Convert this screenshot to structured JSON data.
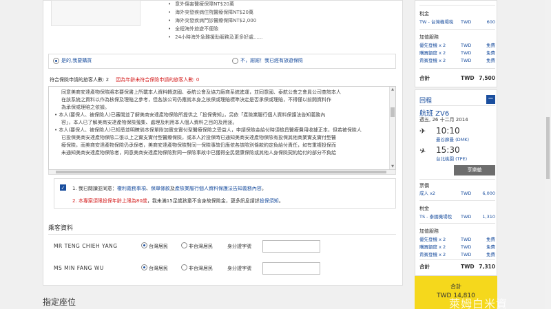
{
  "insurance": {
    "bullets": [
      "意外傷害醫療保障NT$20萬",
      "海外突發疾病住院醫療保障NT$20萬",
      "海外突發疾病門診醫療保障NT$2,000",
      "全程海外旅遊不便險",
      "24小時海外急難援助服務及更多好處......"
    ],
    "yes_label": "是的,我要購買",
    "no_label": "不，謝謝！我已經有旅遊保險",
    "eligible_label": "符合保險申請的旅客人數: 2",
    "ineligible_label": "因為年齡未符合保險申請的旅客人數: 0",
    "terms": [
      "同意美商安達產物保險將本要保書上所載本人資料轉送國、泰航公會及協力廠商系統進運，並同意國、泰航公會之會員公司查詢本人",
      "在該系統之資料以作為核保及理賠之參考，但各該公司仍應就本身之核保或理賠標準決定是否承保或理賠，不得僅以前開資料作",
      "為承保或理賠之依據。",
      "本人(要保人、被保險人)已審閱並了解美商安達產物保險所提供之「投保需知」，另依「產險業履行個人資料保護法告知義務內",
      "容」，本人已了解美商安達產物保險蒐集、處理及利用本人個人資料之目的及用途。",
      "本人(要保人、被保險人)已知悉並明瞭倘本保單附加實支實付型醫療保險之受益人，申請保險金給付時須檢具醫療費用收據正本，但若被保險人",
      "已投保美商安達產物保險二張以上之實支實付型醫療保險，或本人於投保時已通知美商安達產物保險有投保其他商業實支實付型醫",
      "療保險，而美商安達產物保險仍承保者，美商安達產物保險對同一保險事故仍應依各該險別條款約定負給付責任，如有重複投保而",
      "未通知美商安達產物保險者，同意美商安達產物保險對同一保險事故中已獲得全民健康保險或其他人身保險契約給付的部分不負給"
    ],
    "agree_1_prefix": "1. 我已閱讀並同意：",
    "agree_1_link1": "權利義務事項",
    "agree_1_mid": "、",
    "agree_1_link2": "保單條款",
    "agree_1_sep": "及",
    "agree_1_link3": "產險業履行個人資料保護法告知義務內容",
    "agree_1_suffix": "。",
    "agree_2_red": "2. 本專案須限投保年齡上限為80歲",
    "agree_2_text": "，我未滿15足歲孩童不含身故保險金，更多訊息請詳",
    "agree_2_link": "投保須知",
    "agree_2_end": "。"
  },
  "passengers": {
    "title": "乘客資料",
    "list": [
      {
        "name": "MR  TENG CHIEH  YANG",
        "resident": "台灣居民",
        "non_resident": "非台灣居民",
        "id_label": "身分證字號",
        "id_value": ""
      },
      {
        "name": "MS  MIN FANG  WU",
        "resident": "台灣居民",
        "non_resident": "非台灣居民",
        "id_label": "身分證字號",
        "id_value": ""
      }
    ]
  },
  "designate_title": "指定座位",
  "summary": {
    "outbound": {
      "tax_label": "稅金",
      "tax_row": {
        "name": "TW - 台灣機場稅",
        "cur": "TWD",
        "amt": "600"
      },
      "addon_label": "加值服務",
      "addons": [
        {
          "name": "優先登機 x 2",
          "cur": "TWD",
          "amt": "免費"
        },
        {
          "name": "購買額度 x 2",
          "cur": "TWD",
          "amt": "免費"
        },
        {
          "name": "貴賓登機 x 2",
          "cur": "TWD",
          "amt": "免費"
        }
      ],
      "total": {
        "label": "合計",
        "cur": "TWD",
        "amt": "7,500"
      }
    },
    "return": {
      "title": "回程",
      "minus": "−",
      "flight": "航班 ZV6",
      "date": "週五, 26 十二月 2014",
      "dep_time": "10:10",
      "dep_airport": "曼谷廊曼 (DMK)",
      "arr_time": "15:30",
      "arr_airport": "台北桃園 (TPE)",
      "cabin": "享樂艙",
      "fare_label": "票價",
      "fare_row": {
        "name": "成人 x2",
        "cur": "TWD",
        "amt": "6,000"
      },
      "tax_label": "稅金",
      "tax_row": {
        "name": "TS - 泰國機場稅",
        "cur": "TWD",
        "amt": "1,310"
      },
      "addon_label": "加值服務",
      "addons": [
        {
          "name": "優先登機 x 2",
          "cur": "TWD",
          "amt": "免費"
        },
        {
          "name": "購買額度 x 2",
          "cur": "TWD",
          "amt": "免費"
        },
        {
          "name": "貴賓登機 x 2",
          "cur": "TWD",
          "amt": "免費"
        }
      ],
      "total": {
        "label": "合計",
        "cur": "TWD",
        "amt": "7,310"
      }
    },
    "checkout_label": "合計",
    "checkout_amount": "TWD 14,810"
  },
  "watermark": "萊姆白米資"
}
